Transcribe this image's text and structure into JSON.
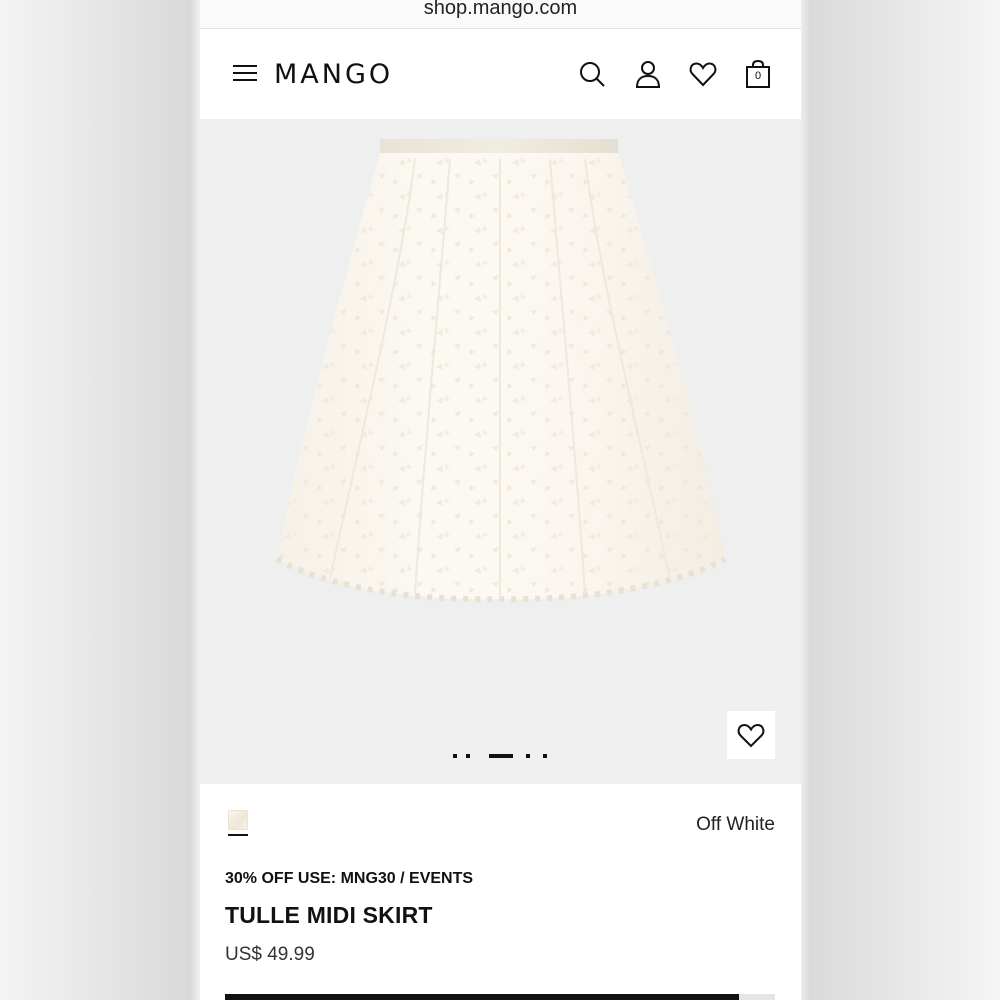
{
  "browser": {
    "url": "shop.mango.com"
  },
  "header": {
    "logo": "MANGO",
    "bag_count": "0"
  },
  "icons": {
    "menu": "hamburger-menu-icon",
    "search": "search-icon",
    "account": "user-icon",
    "wishlist": "heart-icon",
    "bag": "shopping-bag-icon"
  },
  "gallery": {
    "image_count": 5,
    "active_index": 2
  },
  "product": {
    "color_name": "Off White",
    "swatch_color": "#f5efe3",
    "promo": "30% OFF USE: MNG30 / EVENTS",
    "title": "TULLE MIDI SKIRT",
    "price": "US$ 49.99"
  },
  "colors": {
    "text": "#111111",
    "gallery_bg": "#efefef",
    "skirt": "#fbf8f1"
  }
}
